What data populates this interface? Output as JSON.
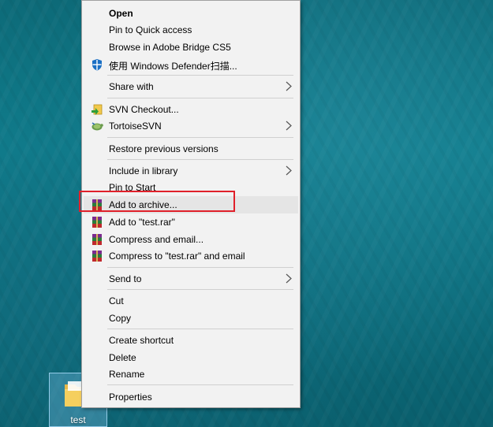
{
  "desktop": {
    "file_label": "test"
  },
  "menu": {
    "items": [
      {
        "label": "Open",
        "bold": true
      },
      {
        "label": "Pin to Quick access"
      },
      {
        "label": "Browse in Adobe Bridge CS5"
      },
      {
        "label": "使用 Windows Defender扫描...",
        "icon": "windows-defender-icon"
      },
      {
        "label": "Share with",
        "submenu": true
      },
      {
        "label": "SVN Checkout...",
        "icon": "svn-checkout-icon"
      },
      {
        "label": "TortoiseSVN",
        "icon": "tortoisesvn-icon",
        "submenu": true
      },
      {
        "label": "Restore previous versions"
      },
      {
        "label": "Include in library",
        "submenu": true
      },
      {
        "label": "Pin to Start"
      },
      {
        "label": "Add to archive...",
        "icon": "winrar-icon",
        "highlighted": true
      },
      {
        "label": "Add to \"test.rar\"",
        "icon": "winrar-icon"
      },
      {
        "label": "Compress and email...",
        "icon": "winrar-icon"
      },
      {
        "label": "Compress to \"test.rar\" and email",
        "icon": "winrar-icon"
      },
      {
        "label": "Send to",
        "submenu": true
      },
      {
        "label": "Cut"
      },
      {
        "label": "Copy"
      },
      {
        "label": "Create shortcut"
      },
      {
        "label": "Delete"
      },
      {
        "label": "Rename"
      },
      {
        "label": "Properties"
      }
    ]
  },
  "colors": {
    "menu_bg": "#f2f2f2",
    "highlight_outline": "#e0202a",
    "desktop_bg": "#0f7d8c"
  }
}
